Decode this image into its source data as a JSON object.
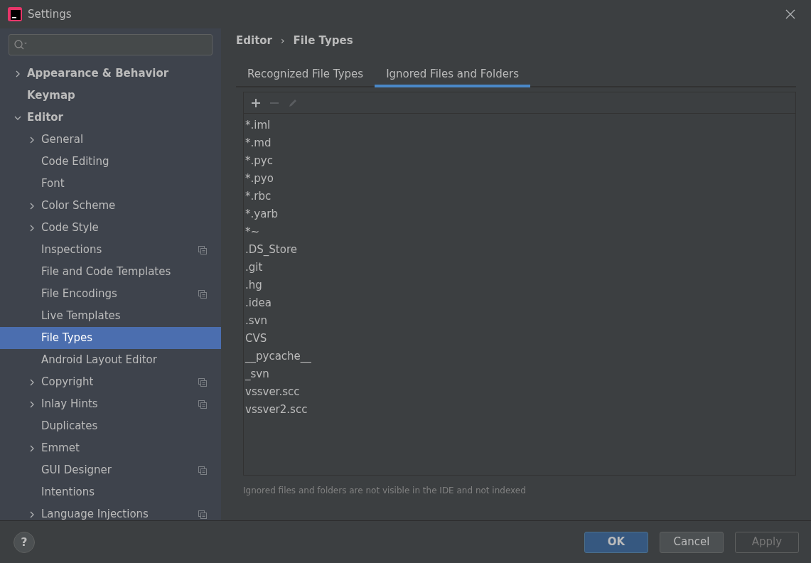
{
  "window": {
    "title": "Settings"
  },
  "sidebar": {
    "items": [
      {
        "label": "Appearance & Behavior",
        "expanded": false,
        "scoped": false,
        "selected": false
      },
      {
        "label": "Keymap",
        "scoped": false,
        "selected": false
      },
      {
        "label": "Editor",
        "expanded": true,
        "scoped": false,
        "selected": false,
        "children": [
          {
            "label": "General",
            "expanded": false,
            "scoped": false,
            "selected": false
          },
          {
            "label": "Code Editing",
            "scoped": false,
            "selected": false
          },
          {
            "label": "Font",
            "scoped": false,
            "selected": false
          },
          {
            "label": "Color Scheme",
            "expanded": false,
            "scoped": false,
            "selected": false
          },
          {
            "label": "Code Style",
            "expanded": false,
            "scoped": false,
            "selected": false
          },
          {
            "label": "Inspections",
            "scoped": true,
            "selected": false
          },
          {
            "label": "File and Code Templates",
            "scoped": false,
            "selected": false
          },
          {
            "label": "File Encodings",
            "scoped": true,
            "selected": false
          },
          {
            "label": "Live Templates",
            "scoped": false,
            "selected": false
          },
          {
            "label": "File Types",
            "scoped": false,
            "selected": true
          },
          {
            "label": "Android Layout Editor",
            "scoped": false,
            "selected": false
          },
          {
            "label": "Copyright",
            "expanded": false,
            "scoped": true,
            "selected": false
          },
          {
            "label": "Inlay Hints",
            "expanded": false,
            "scoped": true,
            "selected": false
          },
          {
            "label": "Duplicates",
            "scoped": false,
            "selected": false
          },
          {
            "label": "Emmet",
            "expanded": false,
            "scoped": false,
            "selected": false
          },
          {
            "label": "GUI Designer",
            "scoped": true,
            "selected": false
          },
          {
            "label": "Intentions",
            "scoped": false,
            "selected": false
          },
          {
            "label": "Language Injections",
            "expanded": false,
            "scoped": true,
            "selected": false
          }
        ]
      }
    ]
  },
  "breadcrumb": {
    "separator": "›",
    "items": [
      "Editor",
      "File Types"
    ]
  },
  "tabs": [
    {
      "label": "Recognized File Types",
      "selected": false
    },
    {
      "label": "Ignored Files and Folders",
      "selected": true
    }
  ],
  "toolbar": [
    {
      "kind": "add",
      "disabled": false
    },
    {
      "kind": "remove",
      "disabled": true
    },
    {
      "kind": "edit",
      "disabled": true
    }
  ],
  "ignored_list": [
    "*.iml",
    "*.md",
    "*.pyc",
    "*.pyo",
    "*.rbc",
    "*.yarb",
    "*~",
    ".DS_Store",
    ".git",
    ".hg",
    ".idea",
    ".svn",
    "CVS",
    "__pycache__",
    "_svn",
    "vssver.scc",
    "vssver2.scc"
  ],
  "hint": "Ignored files and folders are not visible in the IDE and not indexed",
  "help_button": {
    "label": "?"
  },
  "buttons": [
    {
      "label": "OK",
      "default": true,
      "disabled": false
    },
    {
      "label": "Cancel",
      "default": false,
      "disabled": false
    },
    {
      "label": "Apply",
      "default": false,
      "disabled": true
    }
  ]
}
